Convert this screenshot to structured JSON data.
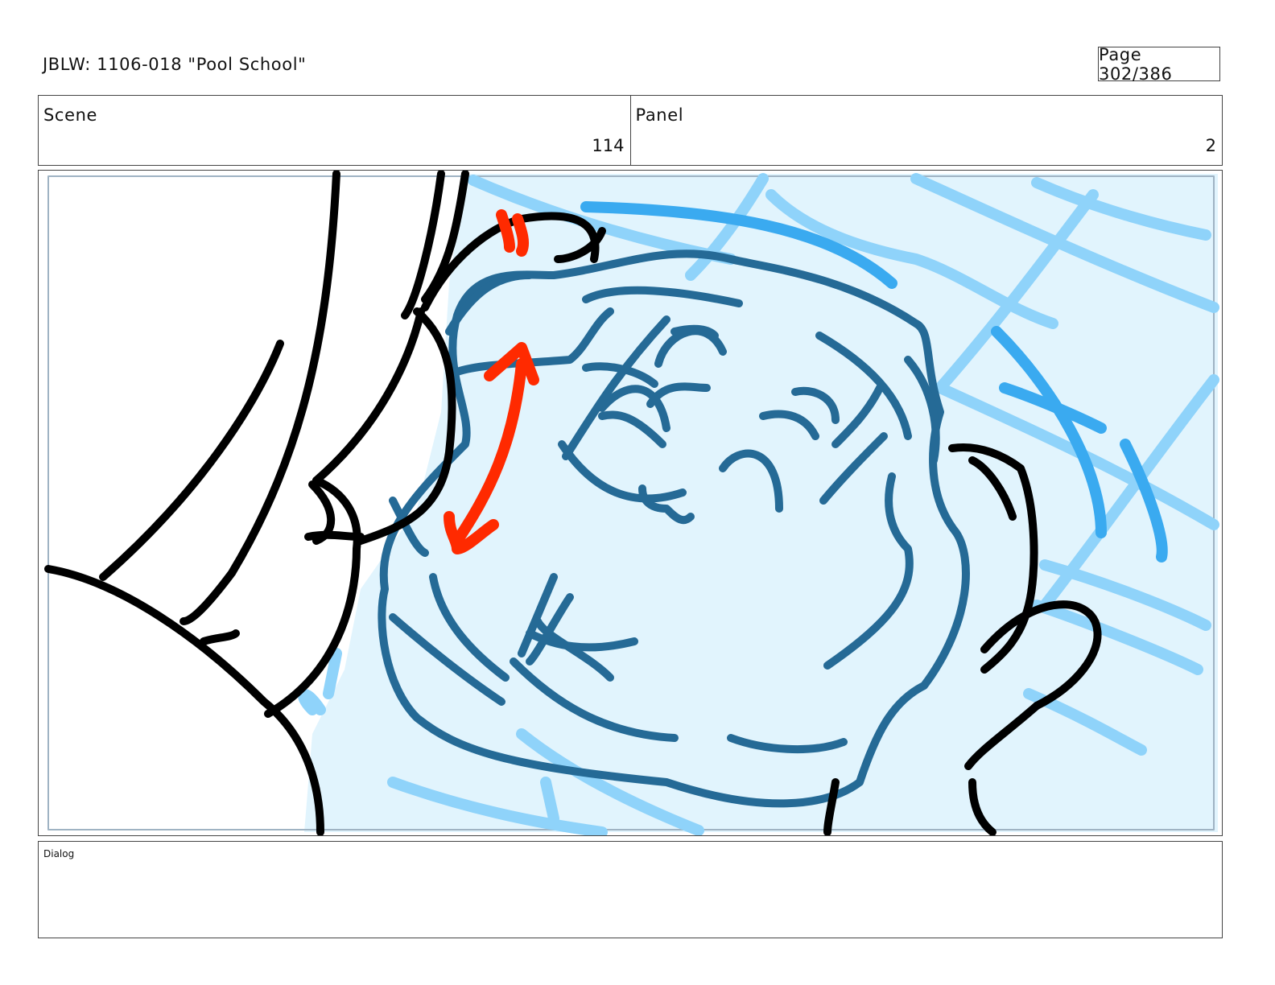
{
  "header": {
    "title": "JBLW: 1106-018 \"Pool School\"",
    "page_label": "Page 302/386"
  },
  "info": {
    "scene_label": "Scene",
    "scene_value": "114",
    "panel_label": "Panel",
    "panel_value": "2"
  },
  "dialog": {
    "label": "Dialog"
  },
  "colors": {
    "water_fill": "#e1f4fd",
    "tile_lines": "#8fd3fa",
    "wave_lines": "#3aaaf0",
    "bubble_lines": "#256a96",
    "arrow_red": "#ff2a00",
    "ink": "#000000"
  },
  "panel_sketch": {
    "description_icon": "storyboard-sketch"
  }
}
